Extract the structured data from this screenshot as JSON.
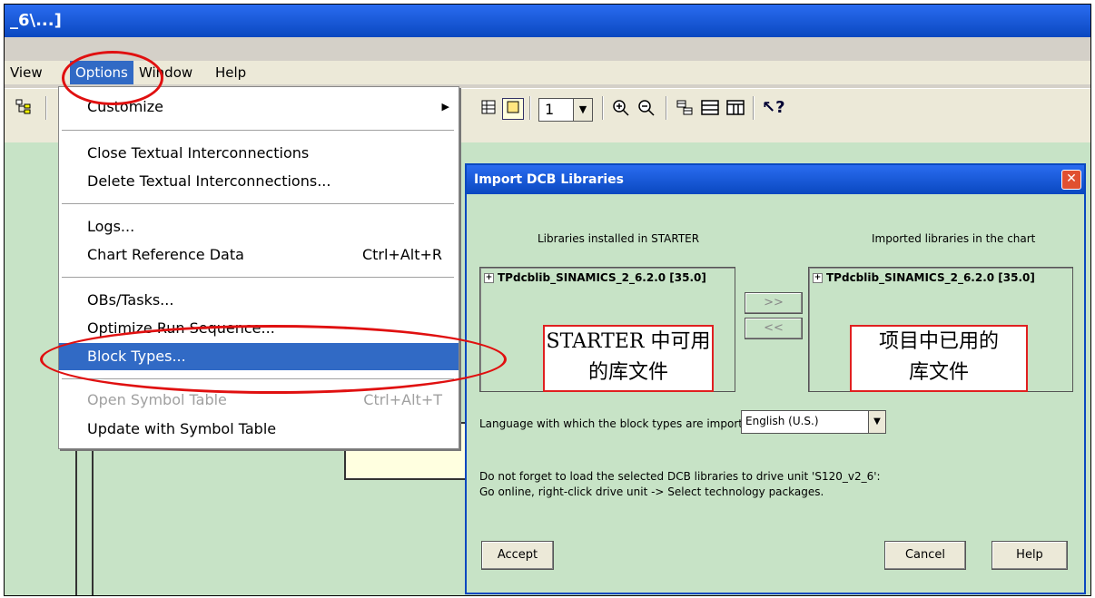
{
  "window": {
    "title": "_6\\...]"
  },
  "menubar": {
    "items": [
      "View",
      "Options",
      "Window",
      "Help"
    ]
  },
  "toolbar": {
    "zoom_value": "1"
  },
  "options_menu": {
    "items": [
      {
        "label": "Customize",
        "accel": "",
        "state": "normal",
        "submenu": true
      },
      {
        "label": "Close Textual Interconnections",
        "accel": "",
        "state": "normal"
      },
      {
        "label": "Delete Textual Interconnections...",
        "accel": "",
        "state": "normal"
      },
      {
        "label": "Logs...",
        "accel": "",
        "state": "normal"
      },
      {
        "label": "Chart Reference Data",
        "accel": "Ctrl+Alt+R",
        "state": "normal"
      },
      {
        "label": "OBs/Tasks...",
        "accel": "",
        "state": "normal"
      },
      {
        "label": "Optimize Run Sequence...",
        "accel": "",
        "state": "normal"
      },
      {
        "label": "Block Types...",
        "accel": "",
        "state": "highlighted"
      },
      {
        "label": "Open Symbol Table",
        "accel": "Ctrl+Alt+T",
        "state": "disabled"
      },
      {
        "label": "Update with Symbol Table",
        "accel": "",
        "state": "normal"
      }
    ]
  },
  "dialog": {
    "title": "Import DCB Libraries",
    "left_header": "Libraries installed in STARTER",
    "right_header": "Imported libraries in the chart",
    "left_item": "TPdcblib_SINAMICS_2_6.2.0 [35.0]",
    "right_item": "TPdcblib_SINAMICS_2_6.2.0 [35.0]",
    "add_button": ">>",
    "remove_button": "<<",
    "language_label": "Language with which the block types are imported:",
    "language_value": "English (U.S.)",
    "note_line1": "Do not forget to load the selected DCB libraries to drive unit 'S120_v2_6':",
    "note_line2": "Go online, right-click drive unit -> Select technology packages.",
    "accept_button": "Accept",
    "cancel_button": "Cancel",
    "help_button": "Help"
  },
  "annotations": {
    "left_line1": "STARTER 中可用",
    "left_line2": "的库文件",
    "right_line1": "项目中已用的",
    "right_line2": "库文件"
  },
  "colors": {
    "annotation_red": "#e01010",
    "highlight": "#316ac5",
    "canvas": "#c7e3c6"
  }
}
